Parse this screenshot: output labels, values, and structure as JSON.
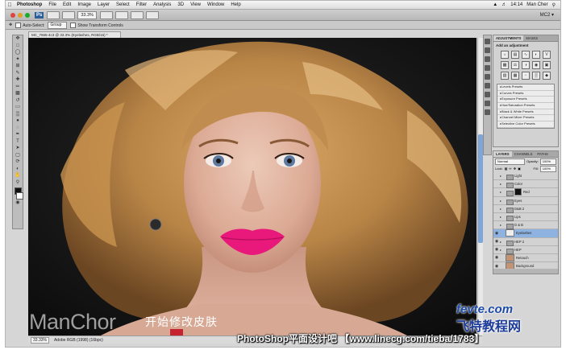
{
  "menubar": {
    "app": "Photoshop",
    "items": [
      "File",
      "Edit",
      "Image",
      "Layer",
      "Select",
      "Filter",
      "Analysis",
      "3D",
      "View",
      "Window",
      "Help"
    ],
    "time": "14:14",
    "user": "Man Cher"
  },
  "appbar": {
    "badge": "Ps",
    "zoom": "33.3%",
    "workspace": "MC2 ▾"
  },
  "options": {
    "auto_select": "Auto-Select:",
    "auto_select_value": "Group",
    "transform": "Show Transform Controls"
  },
  "document": {
    "tab_title": "MC_7665-4c3 @ 33.3% (Eyelashes, RGB/16) *",
    "zoom": "33.33%",
    "doc_info": "Adobe RGB (1998) (16bpc)"
  },
  "adjustments": {
    "tab_active": "ADJUSTMENTS",
    "tab_other": "MASKS",
    "header": "Add an adjustment",
    "presets": [
      "Levels Presets",
      "Curves Presets",
      "Exposure Presets",
      "Hue/Saturation Presets",
      "Black & White Presets",
      "Channel Mixer Presets",
      "Selective Color Presets"
    ]
  },
  "layers": {
    "tabs": [
      "LAYERS",
      "CHANNELS",
      "PATHS"
    ],
    "blend_mode": "Normal",
    "opacity_label": "Opacity:",
    "opacity": "100%",
    "lock_label": "Lock:",
    "fill_label": "Fill:",
    "fill": "100%",
    "items": [
      {
        "name": "Light",
        "visible": false
      },
      {
        "name": "Color",
        "visible": false
      },
      {
        "name": "Red",
        "visible": false
      },
      {
        "name": "Eyes",
        "visible": false
      },
      {
        "name": "D&B 2",
        "visible": false
      },
      {
        "name": "Lips",
        "visible": false
      },
      {
        "name": "D & B",
        "visible": false
      },
      {
        "name": "Eyelashes",
        "visible": true
      },
      {
        "name": "HEP 2",
        "visible": true
      },
      {
        "name": "HEP",
        "visible": true
      },
      {
        "name": "Retouch",
        "visible": true
      },
      {
        "name": "Background",
        "visible": true
      }
    ]
  },
  "watermarks": {
    "author": "ManChor",
    "caption_cn": "开始修改皮肤",
    "forum": "PhotoShop平面设计吧 【www.linecg.com/tieba/1783】",
    "logo_top": "fevte.com",
    "logo_bottom": "飞特教程网"
  },
  "colors": {
    "highlight": "#8fb3e0",
    "lips": "#e8197a",
    "logo": "#1b4aa5"
  }
}
